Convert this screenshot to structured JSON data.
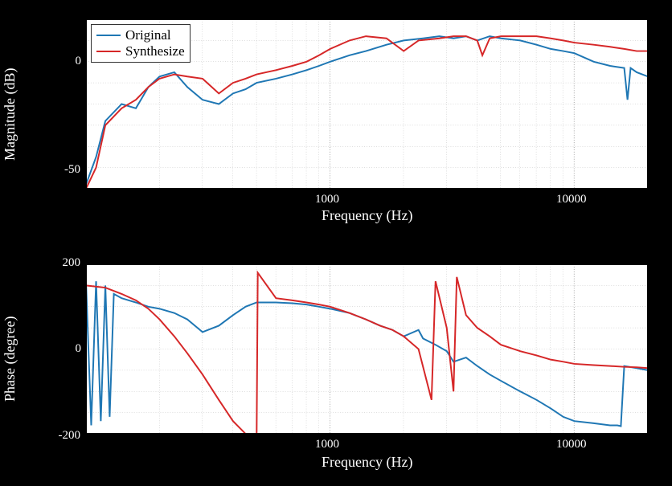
{
  "chart_data": [
    {
      "type": "line",
      "title": "",
      "xlabel": "Frequency (Hz)",
      "ylabel": "Magnitude (dB)",
      "xscale": "log",
      "xlim": [
        100,
        20000
      ],
      "ylim": [
        -60,
        20
      ],
      "xticks": [
        100,
        200,
        500,
        1000,
        2000,
        5000,
        10000
      ],
      "xticklabels": [
        "",
        "",
        "",
        "1000",
        "",
        "",
        "10000"
      ],
      "yticks": [
        -60,
        -50,
        -40,
        -30,
        -20,
        -10,
        0,
        10,
        20
      ],
      "yticklabels": [
        "",
        "-50",
        "",
        "",
        "",
        "",
        "0",
        "",
        ""
      ],
      "legend": [
        "Original",
        "Synthesize"
      ],
      "legend_pos": "top-left-inset",
      "series": [
        {
          "name": "Original",
          "color": "#1f77b4",
          "x": [
            100,
            110,
            120,
            140,
            160,
            180,
            200,
            230,
            260,
            300,
            350,
            400,
            450,
            500,
            600,
            700,
            800,
            900,
            1000,
            1200,
            1400,
            1700,
            2000,
            2400,
            2800,
            3200,
            3600,
            4000,
            4500,
            5000,
            6000,
            7000,
            8000,
            9000,
            10000,
            12000,
            14000,
            16000,
            16500,
            17000,
            18000,
            20000
          ],
          "y": [
            -58,
            -45,
            -28,
            -20,
            -22,
            -12,
            -7,
            -5,
            -12,
            -18,
            -20,
            -15,
            -13,
            -10,
            -8,
            -6,
            -4,
            -2,
            0,
            3,
            5,
            8,
            10,
            11,
            12,
            11,
            12,
            10,
            12,
            11,
            10,
            8,
            6,
            5,
            4,
            0,
            -2,
            -3,
            -18,
            -3,
            -5,
            -7
          ]
        },
        {
          "name": "Synthesize",
          "color": "#d62728",
          "x": [
            100,
            110,
            120,
            140,
            160,
            180,
            200,
            230,
            260,
            300,
            350,
            400,
            450,
            500,
            600,
            700,
            800,
            900,
            1000,
            1200,
            1400,
            1700,
            2000,
            2300,
            2800,
            3200,
            3600,
            4000,
            4200,
            4500,
            5000,
            6000,
            7000,
            8000,
            9000,
            10000,
            12000,
            14000,
            16000,
            18000,
            20000
          ],
          "y": [
            -60,
            -50,
            -30,
            -22,
            -18,
            -12,
            -8,
            -6,
            -7,
            -8,
            -15,
            -10,
            -8,
            -6,
            -4,
            -2,
            0,
            3,
            6,
            10,
            12,
            11,
            5,
            10,
            11,
            12,
            12,
            10,
            3,
            11,
            12,
            12,
            12,
            11,
            10,
            9,
            8,
            7,
            6,
            5,
            5
          ]
        }
      ]
    },
    {
      "type": "line",
      "title": "",
      "xlabel": "Frequency (Hz)",
      "ylabel": "Phase (degree)",
      "xscale": "log",
      "xlim": [
        100,
        20000
      ],
      "ylim": [
        -200,
        200
      ],
      "xticks": [
        100,
        200,
        500,
        1000,
        2000,
        5000,
        10000
      ],
      "xticklabels": [
        "",
        "",
        "",
        "1000",
        "",
        "",
        "10000"
      ],
      "yticks": [
        -200,
        -150,
        -100,
        -50,
        0,
        50,
        100,
        150,
        200
      ],
      "yticklabels": [
        "-200",
        "",
        "",
        "",
        "0",
        "",
        "",
        "",
        "200"
      ],
      "series": [
        {
          "name": "Original",
          "color": "#1f77b4",
          "x": [
            100,
            105,
            110,
            115,
            120,
            125,
            130,
            140,
            160,
            180,
            200,
            230,
            260,
            300,
            350,
            400,
            450,
            500,
            600,
            700,
            800,
            900,
            1000,
            1200,
            1400,
            1600,
            1800,
            2000,
            2300,
            2400,
            2700,
            3000,
            3200,
            3600,
            4000,
            4500,
            5000,
            6000,
            7000,
            8000,
            9000,
            10000,
            12000,
            14000,
            15000,
            15500,
            16000,
            18000,
            20000
          ],
          "y": [
            160,
            -180,
            160,
            -170,
            150,
            -160,
            130,
            120,
            110,
            100,
            95,
            85,
            70,
            40,
            55,
            80,
            100,
            110,
            110,
            108,
            105,
            100,
            95,
            85,
            70,
            55,
            45,
            30,
            45,
            25,
            10,
            -5,
            -30,
            -20,
            -40,
            -60,
            -75,
            -100,
            -120,
            -140,
            -160,
            -170,
            -175,
            -180,
            -180,
            -182,
            -40,
            -45,
            -50
          ]
        },
        {
          "name": "Synthesize",
          "color": "#d62728",
          "x": [
            100,
            120,
            140,
            160,
            180,
            200,
            230,
            260,
            300,
            350,
            400,
            450,
            500,
            505,
            600,
            700,
            800,
            900,
            1000,
            1200,
            1400,
            1600,
            1800,
            2000,
            2300,
            2600,
            2700,
            3000,
            3200,
            3300,
            3600,
            4000,
            4500,
            5000,
            6000,
            7000,
            8000,
            9000,
            10000,
            12000,
            14000,
            16000,
            18000,
            20000
          ],
          "y": [
            150,
            145,
            130,
            115,
            95,
            70,
            30,
            -10,
            -60,
            -120,
            -170,
            -200,
            -200,
            180,
            120,
            115,
            110,
            105,
            100,
            85,
            70,
            55,
            45,
            30,
            0,
            -120,
            160,
            50,
            -100,
            170,
            80,
            50,
            30,
            10,
            -5,
            -15,
            -25,
            -30,
            -35,
            -38,
            -40,
            -42,
            -43,
            -45
          ]
        }
      ]
    }
  ],
  "colors": {
    "original": "#1f77b4",
    "synthesize": "#d62728"
  },
  "labels": {
    "magnitude_ylabel": "Magnitude (dB)",
    "phase_ylabel": "Phase (degree)",
    "xlabel": "Frequency (Hz)",
    "legend_original": "Original",
    "legend_synthesize": "Synthesize",
    "tick_1000": "1000",
    "tick_10000": "10000",
    "tick_0": "0",
    "tick_m50": "-50",
    "tick_200": "200",
    "tick_m200": "-200"
  }
}
